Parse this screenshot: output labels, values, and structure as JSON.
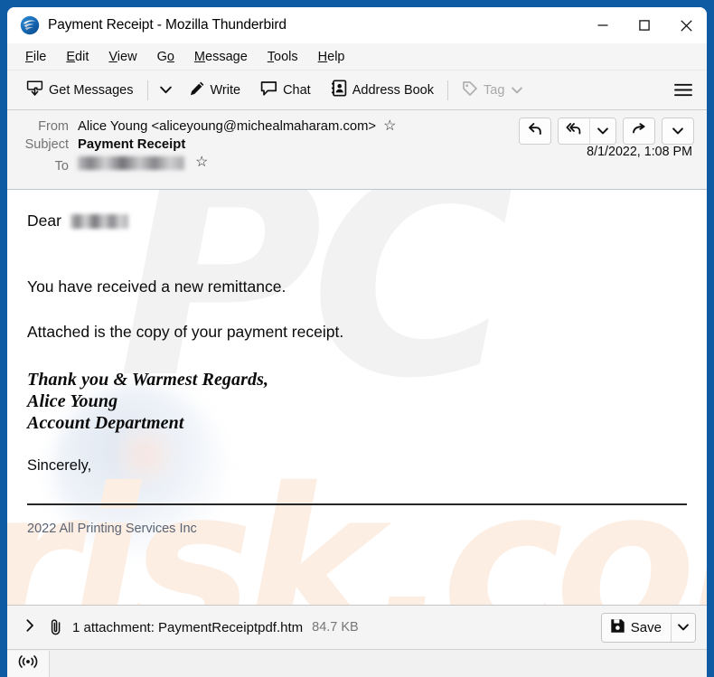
{
  "window": {
    "title": "Payment Receipt - Mozilla Thunderbird",
    "app_icon": "thunderbird-logo",
    "controls": {
      "minimize": "minimize-icon",
      "maximize": "maximize-icon",
      "close": "close-icon"
    },
    "frame_color": "#0e5ba4"
  },
  "menubar": {
    "items": [
      {
        "label": "File",
        "accel": "F"
      },
      {
        "label": "Edit",
        "accel": "E"
      },
      {
        "label": "View",
        "accel": "V"
      },
      {
        "label": "Go",
        "accel": "o"
      },
      {
        "label": "Message",
        "accel": "M"
      },
      {
        "label": "Tools",
        "accel": "T"
      },
      {
        "label": "Help",
        "accel": "H"
      }
    ]
  },
  "toolbar": {
    "get_messages": "Get Messages",
    "write": "Write",
    "chat": "Chat",
    "address_book": "Address Book",
    "tag": "Tag",
    "tag_disabled": true,
    "menu_icon": "hamburger-icon"
  },
  "message_header": {
    "from_label": "From",
    "from_value": "Alice Young <aliceyoung@michealmaharam.com>",
    "subject_label": "Subject",
    "subject_value": "Payment Receipt",
    "to_label": "To",
    "to_value_redacted": true,
    "date": "8/1/2022, 1:08 PM",
    "actions": [
      {
        "name": "reply",
        "icon": "reply-icon"
      },
      {
        "name": "reply-all",
        "icon": "reply-all-icon"
      },
      {
        "name": "reply-all-menu",
        "icon": "chevron-down-icon"
      },
      {
        "name": "forward",
        "icon": "forward-arrow-icon"
      },
      {
        "name": "more",
        "icon": "chevron-down-icon"
      }
    ]
  },
  "body": {
    "greeting_prefix": "Dear",
    "greeting_redacted": true,
    "line1": "You have received a new remittance.",
    "line2": "Attached is the copy of your payment receipt.",
    "signature": [
      "Thank you & Warmest Regards,",
      "Alice Young",
      "Account Department"
    ],
    "closing": "Sincerely,",
    "footer": "2022 All Printing Services Inc",
    "watermark_primary": "PC",
    "watermark_secondary": "risk.com"
  },
  "attachment_bar": {
    "expand_icon": "chevron-right-icon",
    "paperclip_icon": "paperclip-icon",
    "text": "1 attachment: PaymentReceiptpdf.htm",
    "size": "84.7 KB",
    "save_label": "Save",
    "save_icon": "floppy-save-icon",
    "save_caret_icon": "chevron-down-icon"
  },
  "statusbar": {
    "offline_icon": "broadcast-status-icon"
  }
}
